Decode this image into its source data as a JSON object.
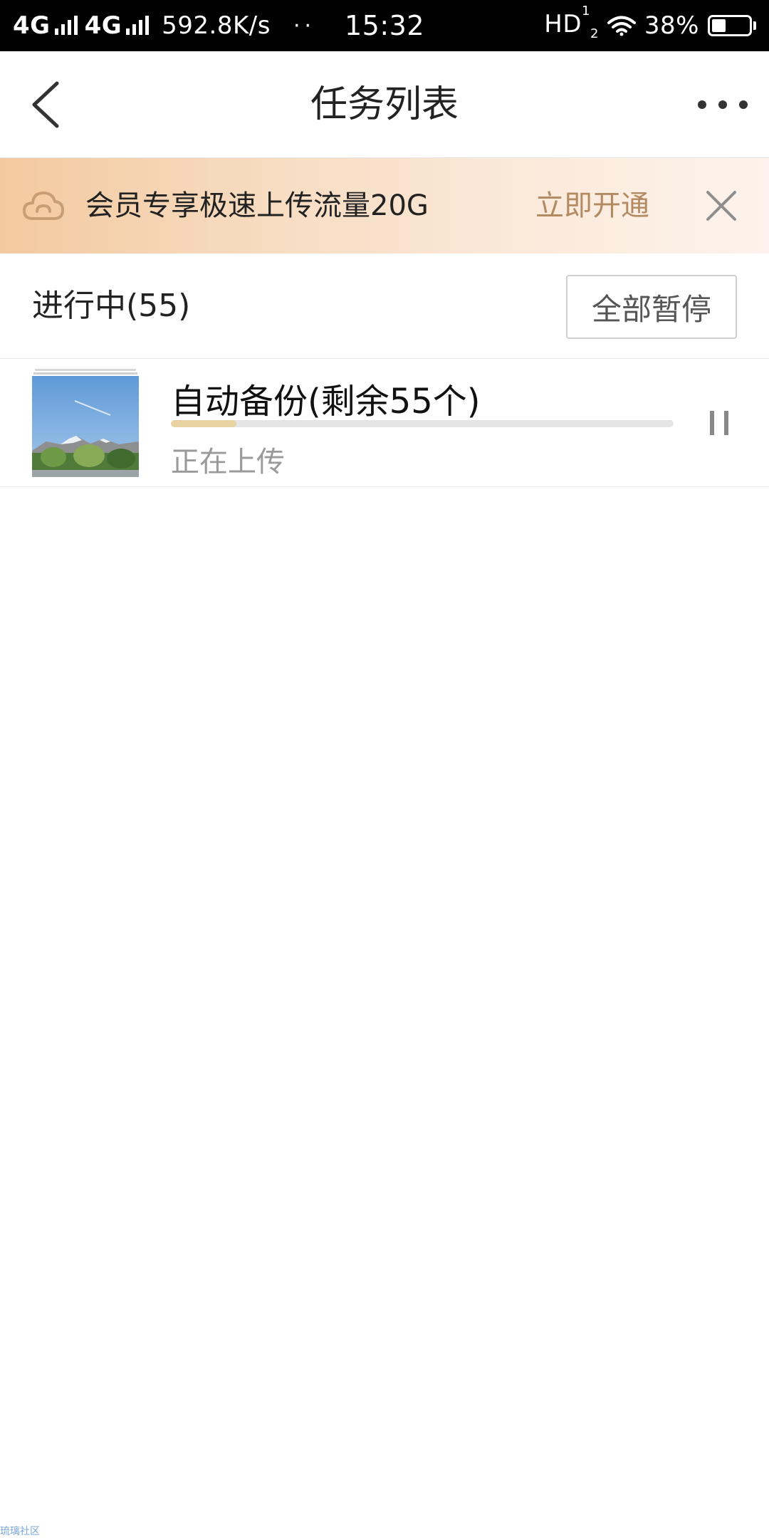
{
  "status_bar": {
    "net1": "4G",
    "net2": "4G",
    "speed": "592.8K/s",
    "dots": "··",
    "time": "15:32",
    "hd": "HD",
    "hd_sup": "1",
    "hd_sub": "2",
    "battery": "38%",
    "battery_level": 0.38
  },
  "header": {
    "title": "任务列表",
    "back_icon": "back-chevron-icon",
    "more_icon": "more-dots-icon"
  },
  "promo": {
    "text": "会员专享极速上传流量20G",
    "action": "立即开通",
    "icon": "cloud-icon",
    "close_icon": "close-icon",
    "gradient_start": "#f3c9a0",
    "action_color": "#b38b62"
  },
  "section": {
    "title": "进行中(55)",
    "pause_all": "全部暂停"
  },
  "tasks": [
    {
      "title": "自动备份(剩余55个)",
      "status": "正在上传",
      "progress": 0.13,
      "progress_color": "#e9d3a3",
      "pause_icon": "pause-icon"
    }
  ],
  "watermark": "琉璃社区"
}
